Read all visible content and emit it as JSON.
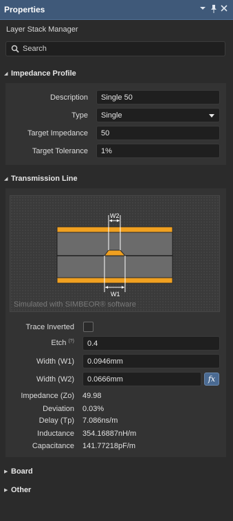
{
  "window": {
    "title": "Properties",
    "controls": {
      "menu": "▾",
      "pin": "📌",
      "close": "✕"
    }
  },
  "subtitle": "Layer Stack Manager",
  "search": {
    "placeholder": "Search",
    "icon": "search-icon"
  },
  "impedance_profile": {
    "header": "Impedance Profile",
    "description": {
      "label": "Description",
      "value": "Single 50"
    },
    "type": {
      "label": "Type",
      "value": "Single"
    },
    "target_impedance": {
      "label": "Target Impedance",
      "value": "50"
    },
    "target_tolerance": {
      "label": "Target Tolerance",
      "value": "1%"
    }
  },
  "transmission_line": {
    "header": "Transmission Line",
    "diagram": {
      "w2_label": "W2",
      "w1_label": "W1",
      "sim_text": "Simulated with SIMBEOR® software"
    },
    "trace_inverted": {
      "label": "Trace Inverted",
      "checked": false
    },
    "etch": {
      "label": "Etch",
      "help": "(?)",
      "value": "0.4"
    },
    "width_w1": {
      "label": "Width (W1)",
      "value": "0.0946mm"
    },
    "width_w2": {
      "label": "Width (W2)",
      "value": "0.0666mm",
      "fx": "fx"
    },
    "readouts": [
      {
        "label": "Impedance (Zo)",
        "value": "49.98"
      },
      {
        "label": "Deviation",
        "value": "0.03%"
      },
      {
        "label": "Delay (Tp)",
        "value": "7.086ns/m"
      },
      {
        "label": "Inductance",
        "value": "354.16887nH/m"
      },
      {
        "label": "Capacitance",
        "value": "141.77218pF/m"
      }
    ]
  },
  "collapsed_sections": [
    {
      "label": "Board"
    },
    {
      "label": "Other"
    }
  ],
  "colors": {
    "titlebar": "#3f5979",
    "copper": "#f0a020",
    "dielectric": "#6b6b6b",
    "background": "#2b2b2b",
    "panel": "#333333"
  }
}
